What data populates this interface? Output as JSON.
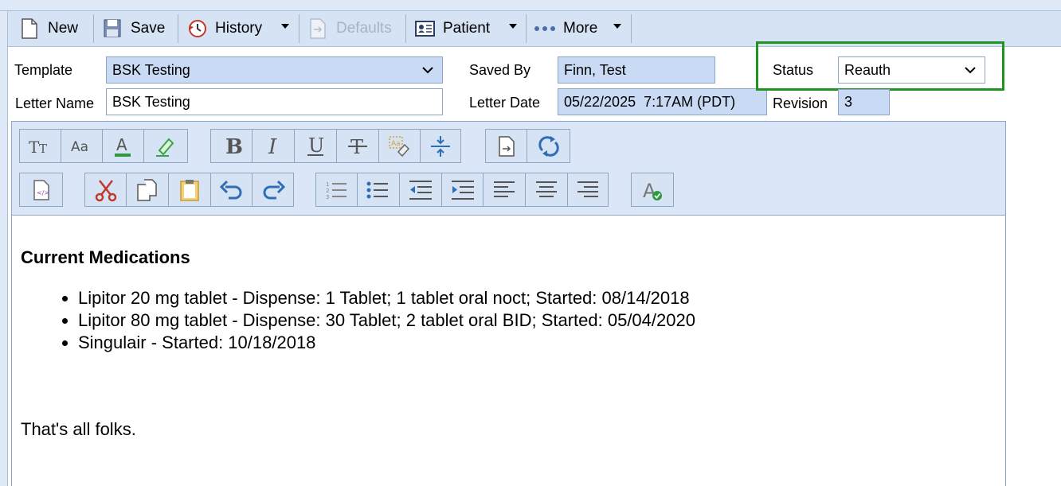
{
  "toolbar": {
    "new_label": "New",
    "save_label": "Save",
    "history_label": "History",
    "defaults_label": "Defaults",
    "patient_label": "Patient",
    "more_label": "More"
  },
  "form": {
    "template_label": "Template",
    "template_value": "BSK Testing",
    "letter_name_label": "Letter Name",
    "letter_name_value": "BSK Testing",
    "saved_by_label": "Saved By",
    "saved_by_value": "Finn, Test",
    "letter_date_label": "Letter Date",
    "letter_date_value": "05/22/2025  7:17AM (PDT)",
    "status_label": "Status",
    "status_value": "Reauth",
    "revision_label": "Revision",
    "revision_value": "3"
  },
  "editor_tools": {
    "row1": [
      "font-family-icon",
      "font-size-icon",
      "font-color-icon",
      "highlight-icon",
      "bold-icon",
      "italic-icon",
      "underline-icon",
      "strikethrough-icon",
      "clear-format-icon",
      "line-height-icon",
      "insert-template-icon",
      "refresh-icon"
    ],
    "row2": [
      "source-icon",
      "cut-icon",
      "copy-icon",
      "paste-icon",
      "undo-icon",
      "redo-icon",
      "numbered-list-icon",
      "bullet-list-icon",
      "outdent-icon",
      "indent-icon",
      "align-left-icon",
      "align-center-icon",
      "align-right-icon",
      "spellcheck-icon"
    ]
  },
  "content": {
    "heading": "Current Medications",
    "medications": [
      "Lipitor 20 mg tablet - Dispense: 1 Tablet; 1 tablet oral noct; Started: 08/14/2018",
      "Lipitor 80 mg tablet - Dispense: 30 Tablet; 2 tablet oral BID; Started: 05/04/2020",
      "Singulair - Started: 10/18/2018"
    ],
    "closing": "That's all folks."
  },
  "colors": {
    "toolbar_bg": "#d6e3f5",
    "field_blue": "#c9daf4",
    "status_highlight": "#219321",
    "icon_blue": "#2f6db4"
  }
}
